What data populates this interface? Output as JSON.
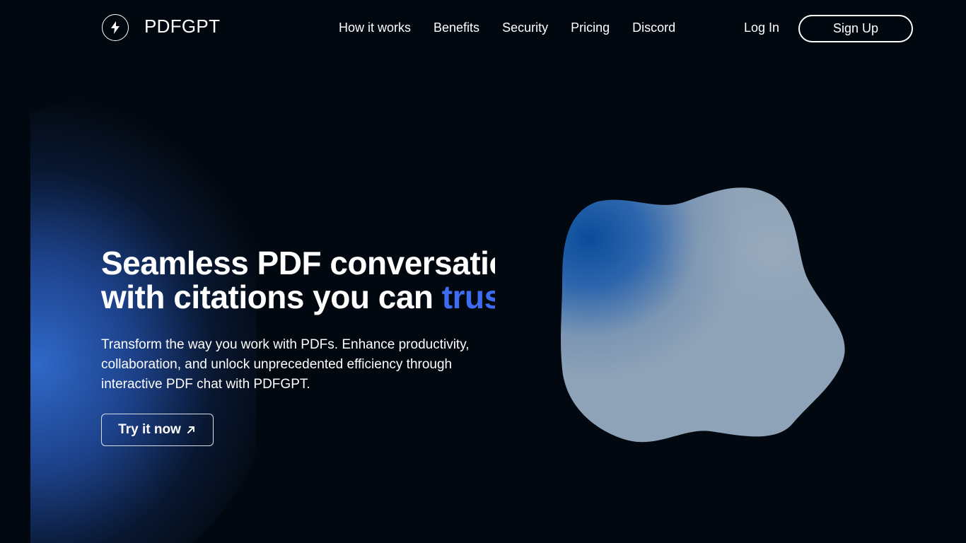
{
  "brand": {
    "name": "PDFGPT",
    "logo_icon": "lightning-bolt-icon"
  },
  "nav": {
    "items": [
      "How it works",
      "Benefits",
      "Security",
      "Pricing",
      "Discord"
    ]
  },
  "auth": {
    "login_label": "Log In",
    "signup_label": "Sign Up"
  },
  "hero": {
    "title_line1": "Seamless PDF conversations",
    "title_line2_prefix": "with citations you can ",
    "title_line2_accent": "trust",
    "description": "Transform the way you work with PDFs. Enhance productivity, collaboration, and unlock unprecedented efficiency through interactive PDF chat with PDFGPT.",
    "cta_label": "Try it now",
    "cta_icon": "arrow-up-right-icon"
  },
  "colors": {
    "background": "#02080f",
    "accent": "#3d6cf0",
    "blob_main": "#8ea3b8",
    "blob_highlight": "#0a4c9a"
  }
}
